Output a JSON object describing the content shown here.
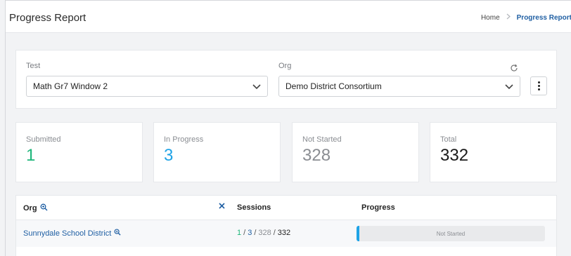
{
  "header": {
    "title": "Progress Report",
    "breadcrumb_home": "Home",
    "breadcrumb_current": "Progress Report"
  },
  "filters": {
    "test_label": "Test",
    "test_value": "Math Gr7 Window 2",
    "org_label": "Org",
    "org_value": "Demo District Consortium"
  },
  "stats": [
    {
      "label": "Submitted",
      "value": "1",
      "color": "#1db67a"
    },
    {
      "label": "In Progress",
      "value": "3",
      "color": "#1fa3e6"
    },
    {
      "label": "Not Started",
      "value": "328",
      "color": "#8a8d92"
    },
    {
      "label": "Total",
      "value": "332",
      "color": "#1a1a1a"
    }
  ],
  "table": {
    "col_org": "Org",
    "col_sessions": "Sessions",
    "col_progress": "Progress",
    "rows": [
      {
        "org": "Sunnydale School District",
        "submitted": "1",
        "in_progress": "3",
        "not_started": "328",
        "total": "332",
        "progress_label": "Not Started",
        "progress_fraction": 0.012
      }
    ]
  },
  "icons": {
    "chevron": "chevron-down-icon",
    "refresh": "refresh-icon",
    "kebab": "kebab-menu-icon",
    "search": "search-icon",
    "clear": "close-icon"
  },
  "colors": {
    "link": "#1f5fa3",
    "sep": "#555555"
  },
  "sep": "/"
}
